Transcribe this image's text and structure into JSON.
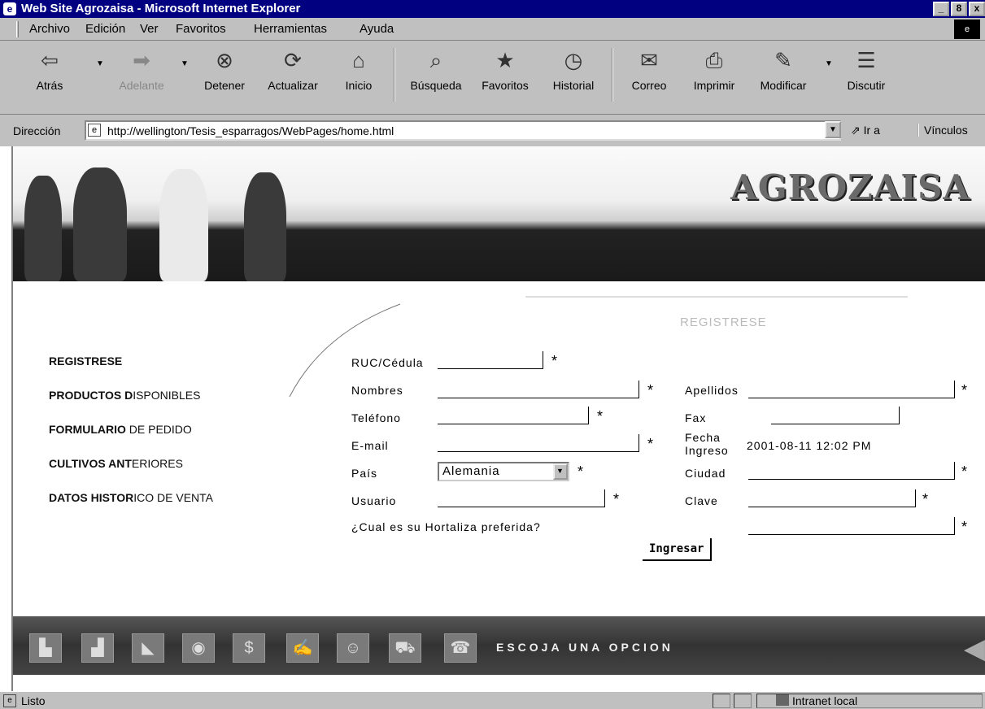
{
  "window": {
    "title": "Web Site Agrozaisa - Microsoft Internet Explorer",
    "buttons": [
      "_",
      "8",
      "x"
    ]
  },
  "menu": [
    "Archivo",
    "Edición",
    "Ver",
    "Favoritos",
    "Herramientas",
    "Ayuda"
  ],
  "toolbar": [
    {
      "label": "Atrás",
      "icon": "back-arrow-icon",
      "glyph": "⇦"
    },
    {
      "label": "Adelante",
      "icon": "forward-arrow-icon",
      "glyph": "➡"
    },
    {
      "label": "Detener",
      "icon": "stop-icon",
      "glyph": "⊗"
    },
    {
      "label": "Actualizar",
      "icon": "refresh-icon",
      "glyph": "⟳"
    },
    {
      "label": "Inicio",
      "icon": "home-icon",
      "glyph": "⌂"
    },
    {
      "label": "Búsqueda",
      "icon": "search-icon",
      "glyph": "⌕"
    },
    {
      "label": "Favoritos",
      "icon": "favorites-icon",
      "glyph": "★"
    },
    {
      "label": "Historial",
      "icon": "history-icon",
      "glyph": "◷"
    },
    {
      "label": "Correo",
      "icon": "mail-icon",
      "glyph": "✉"
    },
    {
      "label": "Imprimir",
      "icon": "print-icon",
      "glyph": "⎙"
    },
    {
      "label": "Modificar",
      "icon": "edit-icon",
      "glyph": "✎"
    },
    {
      "label": "Discutir",
      "icon": "discuss-icon",
      "glyph": "☰"
    }
  ],
  "address": {
    "label": "Dirección",
    "url": "http://wellington/Tesis_esparragos/WebPages/home.html",
    "go": "Ir a",
    "links": "Vínculos"
  },
  "banner": {
    "logo": "AGROZAISA"
  },
  "page": {
    "heading": "REGISTRESE"
  },
  "nav": [
    {
      "bold": "REGISTRESE",
      "rest": ""
    },
    {
      "bold": "PRODUCTOS D",
      "rest": "ISPONIBLES"
    },
    {
      "bold": "FORMULARIO ",
      "rest": "DE PEDIDO"
    },
    {
      "bold": "CULTIVOS ANT",
      "rest": "ERIORES"
    },
    {
      "bold": "DATOS HISTOR",
      "rest": "ICO DE VENTA"
    }
  ],
  "form": {
    "ruc_label": "RUC/Cédula",
    "nombres_label": "Nombres",
    "apellidos_label": "Apellidos",
    "telefono_label": "Teléfono",
    "fax_label": "Fax",
    "email_label": "E-mail",
    "fecha_label_1": "Fecha",
    "fecha_label_2": "Ingreso",
    "fecha_value": "2001-08-11 12:02 PM",
    "pais_label": "País",
    "pais_value": "Alemania",
    "ciudad_label": "Ciudad",
    "usuario_label": "Usuario",
    "clave_label": "Clave",
    "hortaliza_label": "¿Cual es su Hortaliza preferida?",
    "required_mark": "*",
    "submit": "Ingresar"
  },
  "footer": {
    "label": "ESCOJA UNA OPCION",
    "icons": [
      "buildings-icon",
      "chart-icon",
      "map-icon",
      "globe-icon",
      "money-icon",
      "hand-icon",
      "farmer-icon",
      "truck-icon",
      "phone-icon"
    ]
  },
  "status": {
    "text": "Listo",
    "zone": "Intranet local"
  }
}
